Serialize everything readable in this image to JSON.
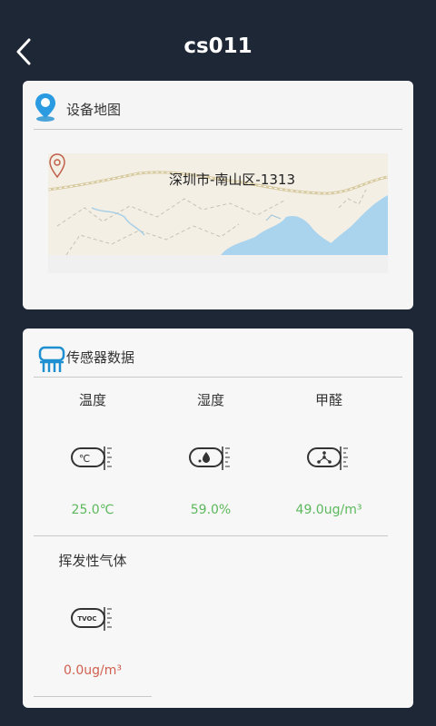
{
  "header": {
    "title": "cs011"
  },
  "map_card": {
    "title": "设备地图",
    "location_label": "深圳市-南山区-1313"
  },
  "sensor_card": {
    "title": "传感器数据",
    "sensors": [
      {
        "name": "温度",
        "value": "25.0℃",
        "icon": "temperature-gauge-icon"
      },
      {
        "name": "湿度",
        "value": "59.0%",
        "icon": "humidity-gauge-icon"
      },
      {
        "name": "甲醛",
        "value": "49.0ug/m³",
        "icon": "formaldehyde-gauge-icon"
      },
      {
        "name": "挥发性气体",
        "value": "0.0ug/m³",
        "icon": "tvoc-gauge-icon",
        "icon_text": "TVOC",
        "value_color": "#d06050"
      }
    ]
  },
  "colors": {
    "background": "#1e2735",
    "value_green": "#5cb85c",
    "value_red": "#d06050",
    "accent_blue": "#1e8fd0"
  }
}
